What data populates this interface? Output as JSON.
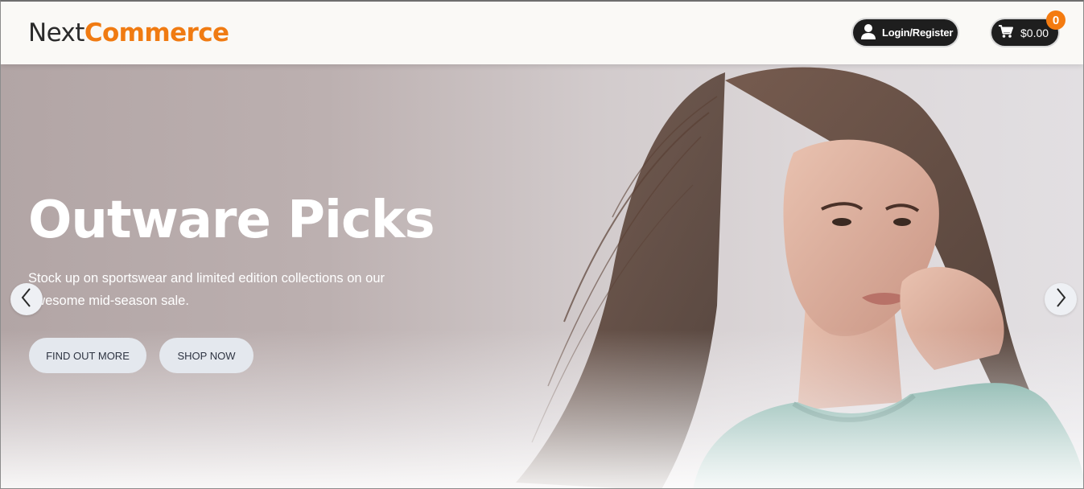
{
  "header": {
    "logo_part1": "Next",
    "logo_part2": "Commerce",
    "login_label": "Login/Register",
    "cart_total": "$0.00",
    "cart_count": "0"
  },
  "hero": {
    "title": "Outware Picks",
    "text": "Stock up on sportswear and limited edition collections on our awesome mid-season sale.",
    "buttons": [
      "FIND OUT MORE",
      "SHOP NOW"
    ]
  },
  "icons": {
    "user": "user-icon",
    "cart": "cart-icon",
    "prev": "chevron-left-icon",
    "next": "chevron-right-icon"
  },
  "colors": {
    "accent": "#f07b12",
    "badge": "#f47b10",
    "pill_bg": "#1e1e1e",
    "button_bg": "#e4e8ee"
  }
}
